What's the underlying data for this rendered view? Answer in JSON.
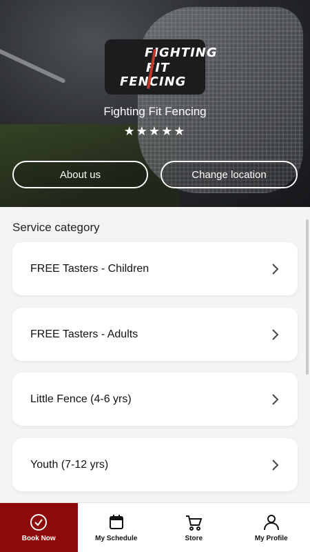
{
  "header": {
    "logo_lines": [
      "FIGHTING",
      "FIT",
      "FENCING"
    ],
    "club_name": "Fighting Fit Fencing",
    "rating_stars": 5,
    "stars_text": "★★★★★",
    "about_button": "About us",
    "location_button": "Change location"
  },
  "main": {
    "section_title": "Service category",
    "categories": [
      {
        "label": "FREE Tasters - Children"
      },
      {
        "label": "FREE Tasters - Adults"
      },
      {
        "label": "Little Fence (4-6 yrs)"
      },
      {
        "label": "Youth (7-12 yrs)"
      }
    ]
  },
  "tabbar": {
    "tabs": [
      {
        "label": "Book Now",
        "icon": "check-circle-icon",
        "active": true
      },
      {
        "label": "My Schedule",
        "icon": "calendar-icon",
        "active": false
      },
      {
        "label": "Store",
        "icon": "cart-icon",
        "active": false
      },
      {
        "label": "My Profile",
        "icon": "user-icon",
        "active": false
      }
    ]
  },
  "colors": {
    "accent": "#8f0b0b",
    "card_bg": "#ffffff",
    "page_bg": "#f4f4f4"
  }
}
